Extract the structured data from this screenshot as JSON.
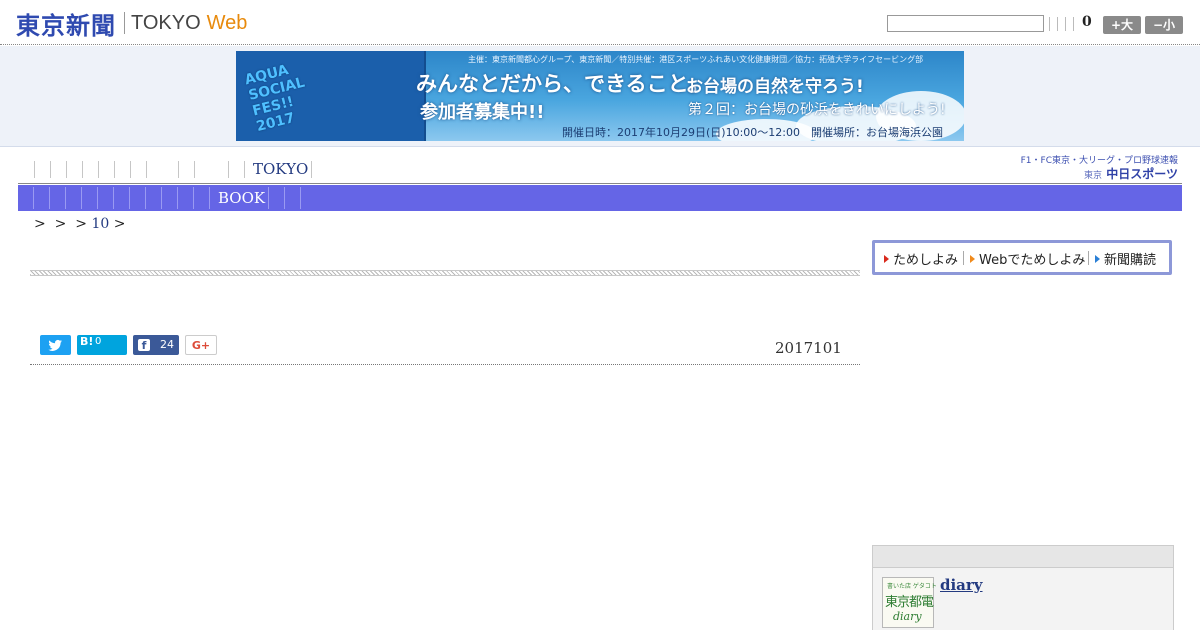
{
  "header": {
    "logo_jp": "東京新聞",
    "logo_tokyo": "TOKYO",
    "logo_web": "Web",
    "search": {
      "value": "",
      "placeholder": ""
    },
    "count": "0",
    "font_large": "+大",
    "font_small": "−小"
  },
  "banner": {
    "shirt_text": "AQUA\nSOCIAL\nFES!!\n2017",
    "credit": "主催：東京新聞都心グループ、東京新聞／特別共催：港区スポーツふれあい文化健康財団／協力：拓殖大学ライフセービング部",
    "main": "みんなとだから、できること。",
    "title2": "お台場の自然を守ろう!",
    "recruit": "参加者募集中!!",
    "round": "第２回：お台場の砂浜をきれいにしよう!",
    "date": "開催日時：2017年10月29日(日)10:00〜12:00　開催場所：お台場海浜公園",
    "colors": {
      "sky": "#4aa6df",
      "shirt": "#1b5fab"
    }
  },
  "section_nav": {
    "tokyo_label": "TOKYO"
  },
  "chunichi": {
    "top": "F1・FC東京・大リーグ・プロ野球速報",
    "logo_small": "東京",
    "logo_main": "中日スポーツ"
  },
  "genre": {
    "book_label": "BOOK",
    "bar_color": "#6565e6"
  },
  "breadcrumb": {
    "sep1": ">",
    "sep2": ">",
    "sep3": ">",
    "link": "10",
    "sep4": ">"
  },
  "share": {
    "hatena_label": "B!",
    "hatena_count": "0",
    "facebook_count": "24",
    "gplus_label": "G+"
  },
  "article": {
    "date": "2017101"
  },
  "subnav": {
    "item1": "ためしよみ",
    "item2": "Webでためしよみ",
    "item3": "新聞購読"
  },
  "sidebar": {
    "diary_thumb_top": "書いた店 ゲタコト",
    "diary_thumb_main": "東京都電",
    "diary_thumb_sub": "diary",
    "diary_link": "diary"
  }
}
